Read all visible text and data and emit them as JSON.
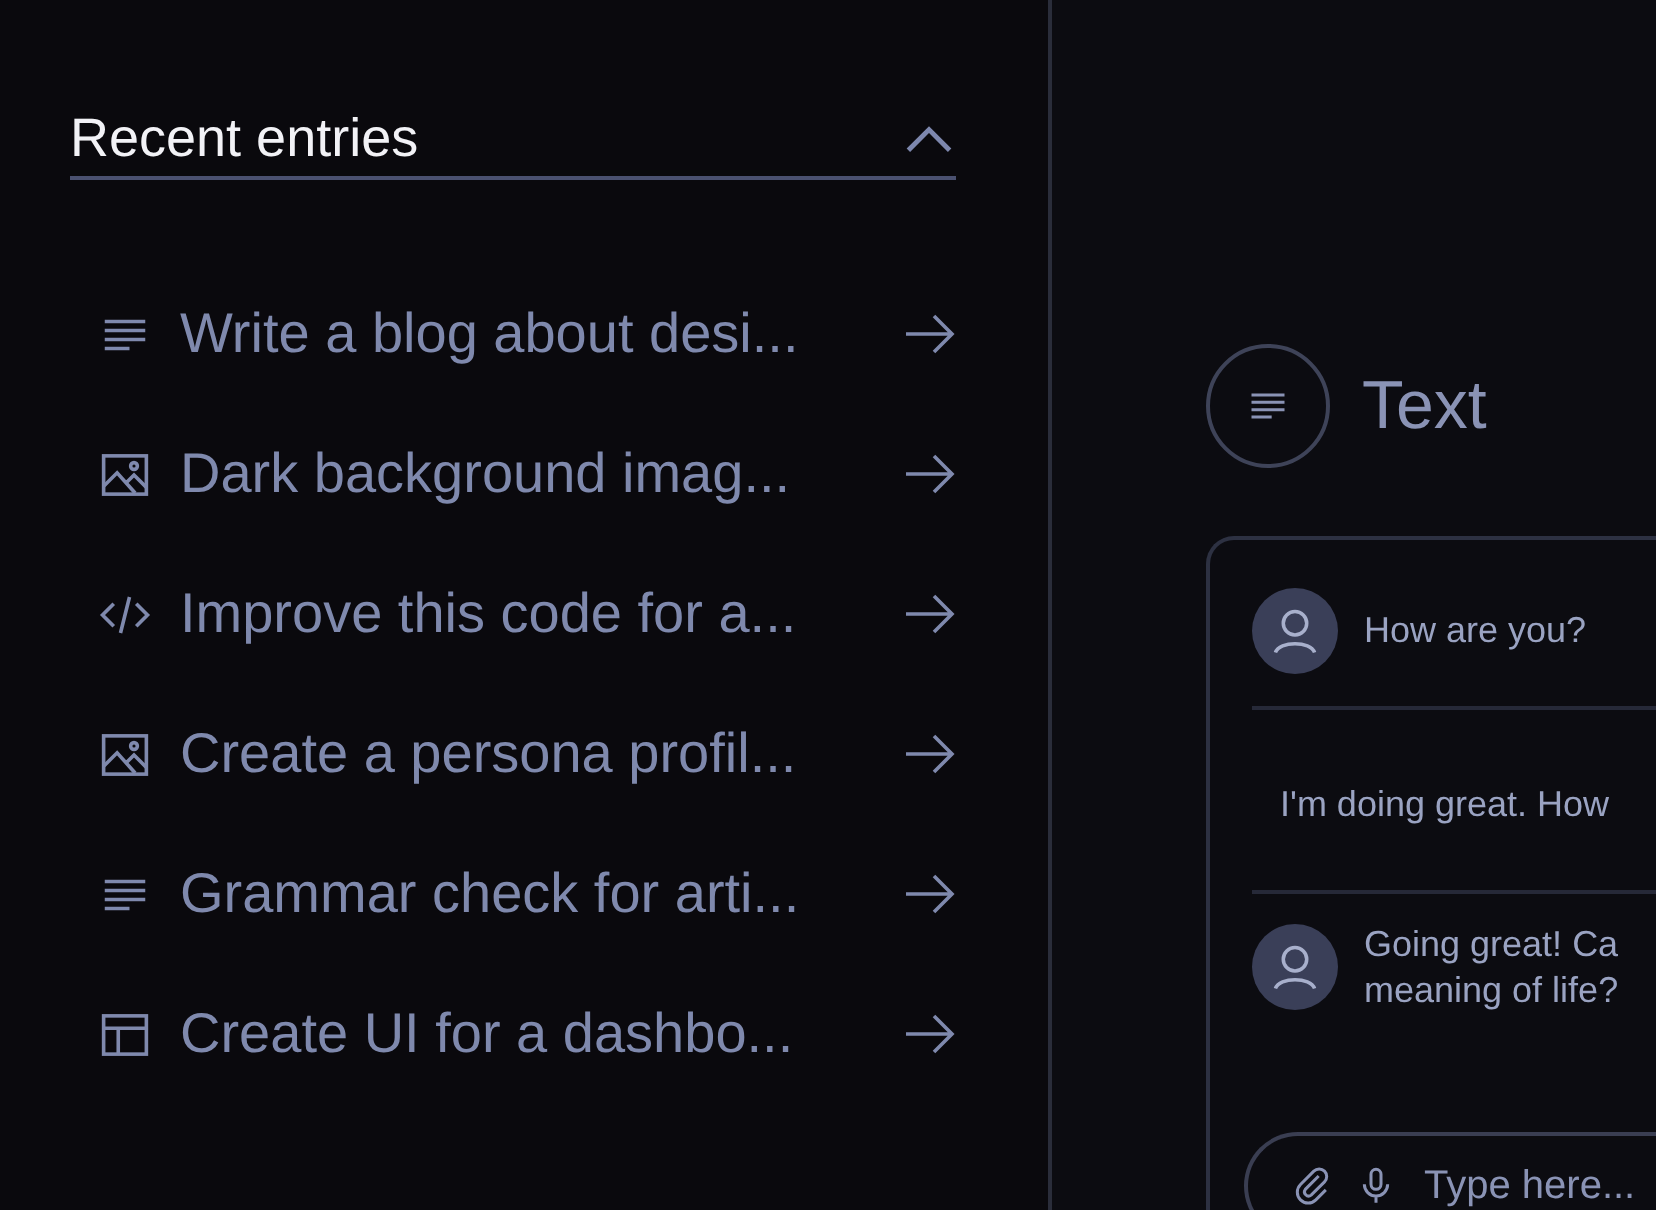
{
  "recent": {
    "title": "Recent entries",
    "expanded": true,
    "items": [
      {
        "kind": "text",
        "label": "Write a blog about desi..."
      },
      {
        "kind": "image",
        "label": "Dark background imag..."
      },
      {
        "kind": "code",
        "label": "Improve this code for a..."
      },
      {
        "kind": "image",
        "label": "Create a persona profil..."
      },
      {
        "kind": "text",
        "label": "Grammar check for arti..."
      },
      {
        "kind": "layout",
        "label": "Create UI for a dashbo..."
      }
    ]
  },
  "mode": {
    "kind": "text",
    "label": "Text"
  },
  "chat": {
    "messages": [
      {
        "kind": "user",
        "text": "How are you?"
      },
      {
        "kind": "assistant",
        "text": "I'm doing great. How"
      },
      {
        "kind": "user",
        "text": "Going great! Ca\nmeaning of life?"
      }
    ],
    "input": {
      "placeholder": "Type here..."
    }
  }
}
